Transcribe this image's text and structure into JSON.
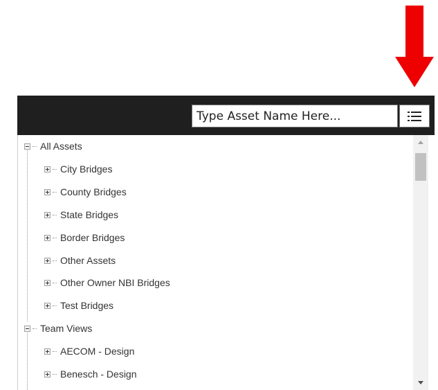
{
  "search": {
    "placeholder": "Type Asset Name Here..."
  },
  "annotation": {
    "arrow_color": "#ee0000"
  },
  "tree": {
    "groups": [
      {
        "label": "All Assets",
        "state": "expanded",
        "children": [
          "City Bridges",
          "County Bridges",
          "State Bridges",
          "Border Bridges",
          "Other Assets",
          "Other Owner NBI Bridges",
          "Test Bridges"
        ]
      },
      {
        "label": "Team Views",
        "state": "expanded",
        "children": [
          "AECOM - Design",
          "Benesch - Design"
        ]
      }
    ]
  }
}
